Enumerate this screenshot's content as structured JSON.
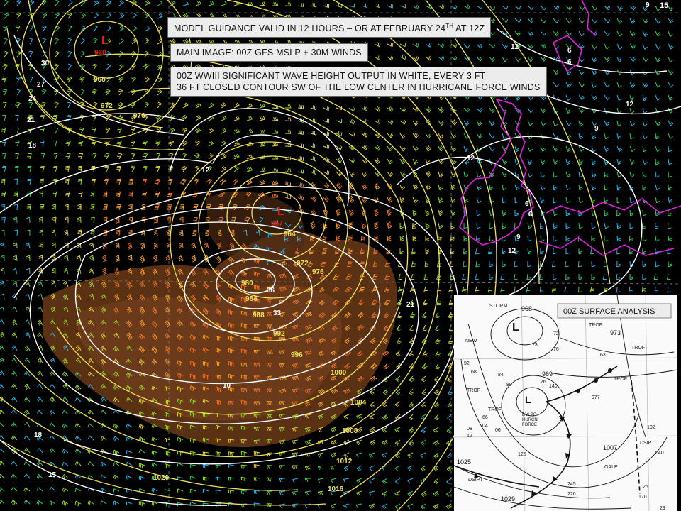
{
  "captions": {
    "title_pre": "MODEL GUIDANCE VALID IN 12 HOURS – OR AT FEBRUARY 24",
    "title_sup": "TH",
    "title_post": " AT 12Z",
    "main_image": "MAIN IMAGE: 00Z GFS MSLP + 30M WINDS",
    "wave_line1": "00Z WWIII SIGNIFICANT WAVE HEIGHT OUTPUT IN WHITE, EVERY 3 FT",
    "wave_line2": "36 FT CLOSED CONTOUR SW OF THE LOW CENTER IN HURRICANE FORCE WINDS"
  },
  "colors": {
    "background": "#000000",
    "isobar": "#f0e35a",
    "wave_contour": "#ffffff",
    "coastline": "#e01ee0",
    "low_marker": "#e0201e",
    "barb_palette": [
      "#2bb6e8",
      "#3cc66a",
      "#9ad12e",
      "#e0d23a",
      "#f19a2e",
      "#e8742a"
    ]
  },
  "main_map": {
    "lows": [
      {
        "symbol": "L",
        "label": "960"
      },
      {
        "symbol": "L",
        "label": "957"
      }
    ],
    "isobar_labels": [
      "968",
      "972",
      "976",
      "964",
      "972",
      "976",
      "980",
      "984",
      "988",
      "992",
      "996",
      "1000",
      "1004",
      "1008",
      "1012",
      "1016",
      "1020"
    ],
    "wave_labels": [
      "30",
      "27",
      "24",
      "21",
      "18",
      "12",
      "36",
      "33",
      "21",
      "12",
      "12",
      "9",
      "9",
      "6",
      "6",
      "12",
      "9",
      "12",
      "6",
      "6",
      "18",
      "15",
      "10"
    ],
    "corner_label": "15"
  },
  "inset": {
    "title": "00Z SURFACE ANALYSIS",
    "labels": {
      "storm": "STORM",
      "new": "NEW",
      "low1_pressure": "968",
      "low2_pressure": "969",
      "hurricane_force": [
        "DVLPG",
        "HURCN",
        "FORCE"
      ],
      "trof_1": "TROF",
      "trof_2": "TROF",
      "trof_3": "TROF",
      "trof_4": "TROF",
      "trof_5": "TROF",
      "dsipt_1": "DSIPT",
      "dsipt_2": "DSIPT",
      "gale": "GALE",
      "p973": "973",
      "p1007": "1007",
      "p1025": "1025",
      "p1029": "1029",
      "obs": [
        "72",
        "73",
        "76",
        "63",
        "80",
        "84",
        "92",
        "08",
        "12",
        "04",
        "125",
        "977",
        "220",
        "245",
        "170",
        "25",
        "29",
        "102",
        "040",
        "140",
        "76",
        "68",
        "66",
        "06"
      ]
    }
  }
}
